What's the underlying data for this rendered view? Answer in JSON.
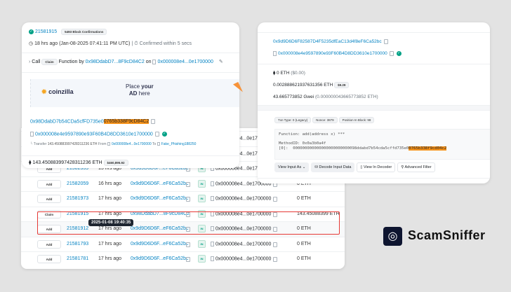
{
  "table": {
    "rows": [
      {
        "method": "Add",
        "block": "",
        "age": "",
        "from": "",
        "to": "0x000008e4...0e1700000",
        "amount": ""
      },
      {
        "method": "Add",
        "block": "",
        "age": "",
        "from": "",
        "to": "0x000008e4...0e1700000",
        "amount": ""
      },
      {
        "method": "Add",
        "block": "21582339",
        "age": "15 hrs ago",
        "from": "0x9d9D6D6F...eF6Ca52bc",
        "direction": "IN",
        "to": "0x000008e4...0e1700000",
        "amount": "0 ETH"
      },
      {
        "method": "Add",
        "block": "21582059",
        "age": "16 hrs ago",
        "from": "0x9d9D6D6F...eF6Ca52bc",
        "direction": "IN",
        "to": "0x000008e4...0e1700000",
        "amount": "0 ETH"
      },
      {
        "method": "Add",
        "block": "21581973",
        "age": "17 hrs ago",
        "from": "0x9d9D6D6F...eF6Ca52bc",
        "direction": "IN",
        "to": "0x000008e4...0e1700000",
        "amount": "0 ETH"
      },
      {
        "method": "Claim",
        "block": "21581915",
        "age": "17 hrs ago",
        "from": "0x98DdabD7...8F9cD84C2",
        "direction": "IN",
        "to": "0x000008e4...0e1700000",
        "amount": "143.45088399 ETH"
      },
      {
        "method": "Add",
        "block": "21581912",
        "age": "17 hrs ago",
        "from": "0x9d9D6D6F...eF6Ca52bc",
        "direction": "IN",
        "to": "0x000008e4...0e1700000",
        "amount": "0 ETH"
      },
      {
        "method": "Add",
        "block": "21581793",
        "age": "17 hrs ago",
        "from": "0x9d9D6D6F...eF6Ca52bc",
        "direction": "IN",
        "to": "0x000008e4...0e1700000",
        "amount": "0 ETH"
      },
      {
        "method": "Add",
        "block": "21581781",
        "age": "17 hrs ago",
        "from": "0x9d9D6D6F...eF6Ca52bc",
        "direction": "IN",
        "to": "0x000008e4...0e1700000",
        "amount": "0 ETH"
      }
    ],
    "tooltip": "2025-01-08 19:40:35",
    "highlight_color": "#e53935"
  },
  "left_card": {
    "block": "21581915",
    "confirmations": "5493 Block Confirmations",
    "time": "18 hrs ago (Jan-08-2025 07:41:11 PM UTC)",
    "confirmed": "Confirmed within 5 secs",
    "call_label": "Call",
    "method": "Claim",
    "function_by": "Function by",
    "caller": "0x98DdabD7...8F9cD84C2",
    "on": "on",
    "contract": "0x000008e4...0e1700000",
    "ad_brand": "coinzilla",
    "ad_text1": "Place",
    "ad_text1b": "your",
    "ad_text2": "AD",
    "ad_text2b": "here",
    "from_prefix": "0x98DdabD7b54CDa5cfFD735e0",
    "from_suffix": "0765b338F9cD84C2",
    "to_full": "0x000008e4e9597890e93F60B4D8DD3610e1700000",
    "transfer_label": "Transfer",
    "transfer_amount": "143.450883997428311236 ETH",
    "transfer_from_label": "From",
    "transfer_from": "0x000008e4...0e1700000",
    "transfer_to_label": "To",
    "transfer_to": "Fake_Phishing188250",
    "value": "143.450883997428311236 ETH",
    "value_usd": "$460,895.92"
  },
  "right_card": {
    "from": "0x9d9D6D6F82587D4F5235dfEaC13d4f8eF6Ca52bc",
    "to": "0x000008e4e9597890e93F60B4D8DD3610e1700000",
    "value": "0 ETH",
    "value_usd": "($0.00)",
    "fee": "0.002888621937631356 ETH",
    "fee_usd": "$9.29",
    "gas_price": "43.665773852 Gwei",
    "gas_price_eth": "(0.000000043665773852 ETH)",
    "txn_type": "Txn Type: 0 (Legacy)",
    "nonce": "Nonce: 3879",
    "position": "Position In Block: 98",
    "input_line1": "Function: add(address x) ***",
    "input_line2": "MethodID: 0x0a3b0a4f",
    "input_line3_prefix": "[0]:  000000000000000000000000098ddabd7b54cda5cffd735e0",
    "input_line3_suffix": "0765b338f9cd04c2",
    "buttons": [
      "View Input As",
      "Decode Input Data",
      "View In Decoder",
      "Advanced Filter"
    ]
  },
  "brand": {
    "name": "ScamSniffer"
  }
}
